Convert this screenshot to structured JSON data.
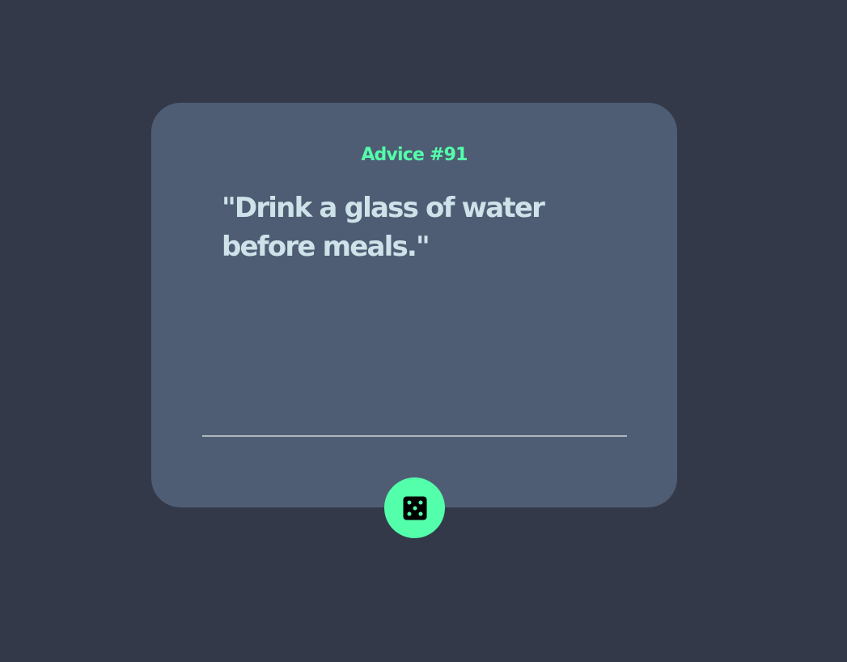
{
  "card": {
    "title": "Advice #91",
    "quote": "\"Drink a glass of water before meals.\""
  },
  "dice_button": {
    "icon": "dice-icon"
  },
  "colors": {
    "page_background": "#333949",
    "card_background": "#4f5d74",
    "accent": "#53ffaa",
    "quote_text": "#cee3e9"
  }
}
